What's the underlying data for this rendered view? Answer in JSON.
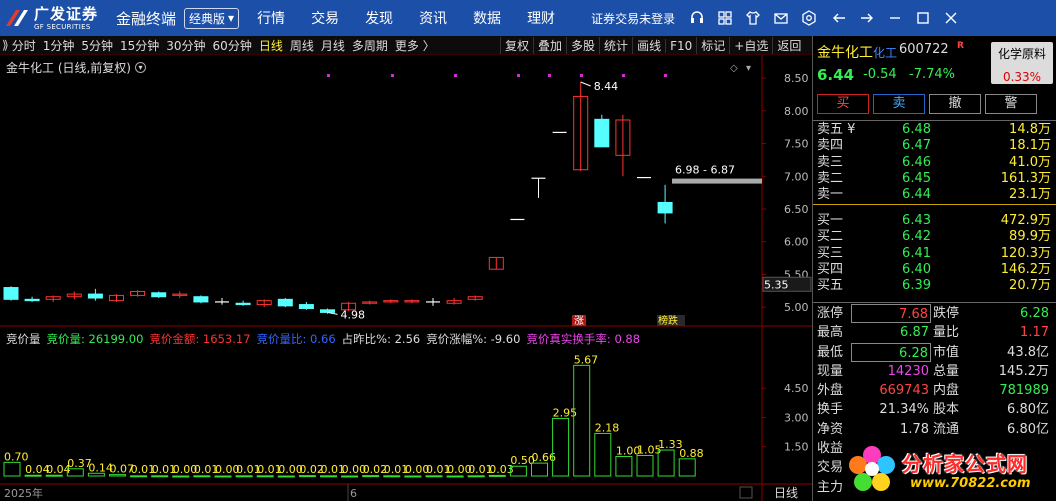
{
  "titlebar": {
    "logo_cn": "广发证券",
    "logo_en": "GF SECURITIES",
    "app_title": "金融终端",
    "edition": "经典版",
    "menu": [
      "行情",
      "交易",
      "发现",
      "资讯",
      "数据",
      "理财"
    ],
    "login": "证券交易未登录"
  },
  "toolbar": {
    "left_items": [
      "分时",
      "1分钟",
      "5分钟",
      "15分钟",
      "30分钟",
      "60分钟",
      "日线",
      "周线",
      "月线",
      "多周期",
      "更多 〉"
    ],
    "active": "日线",
    "right_items": [
      "复权",
      "叠加",
      "多股",
      "统计",
      "画线",
      "F10",
      "标记",
      "+自选",
      "返回"
    ]
  },
  "chart": {
    "stock_label": "金牛化工 (日线,前复权)",
    "high_label": "8.44",
    "low_label": "4.98",
    "range_label": "6.98 - 6.87",
    "current_price_tag": "5.35",
    "zhang_tag": "涨",
    "bang_tag": "榜跌",
    "x_label_start": "2025年",
    "x_label_6": "6",
    "period_tag": "日线"
  },
  "vol_legend": {
    "title": "竞价量",
    "items": [
      {
        "label": "竞价量: 26199.00",
        "color": "#33ee55"
      },
      {
        "label": "竞价金额: 1653.17",
        "color": "#ff3333"
      },
      {
        "label": "竞价量比: 0.66",
        "color": "#3366ff"
      },
      {
        "label": "占昨比%: 2.56",
        "color": "#dddddd"
      },
      {
        "label": "竞价涨幅%: -9.60",
        "color": "#dddddd"
      },
      {
        "label": "竞价真实换手率: 0.88",
        "color": "#ee44ee"
      }
    ]
  },
  "chart_data": [
    {
      "type": "candlestick",
      "title": "金牛化工 (日线,前复权)",
      "y_ticks": [
        8.5,
        8.0,
        7.5,
        7.0,
        6.5,
        6.0,
        5.5,
        5.0
      ],
      "ylim": [
        4.85,
        8.7
      ],
      "candles": [
        {
          "o": 5.3,
          "h": 5.32,
          "l": 5.1,
          "c": 5.12
        },
        {
          "o": 5.12,
          "h": 5.16,
          "l": 5.08,
          "c": 5.1
        },
        {
          "o": 5.12,
          "h": 5.18,
          "l": 5.08,
          "c": 5.16
        },
        {
          "o": 5.16,
          "h": 5.24,
          "l": 5.12,
          "c": 5.2
        },
        {
          "o": 5.2,
          "h": 5.28,
          "l": 5.1,
          "c": 5.14
        },
        {
          "o": 5.1,
          "h": 5.2,
          "l": 5.08,
          "c": 5.18
        },
        {
          "o": 5.18,
          "h": 5.26,
          "l": 5.16,
          "c": 5.24
        },
        {
          "o": 5.22,
          "h": 5.24,
          "l": 5.14,
          "c": 5.16
        },
        {
          "o": 5.18,
          "h": 5.24,
          "l": 5.14,
          "c": 5.2
        },
        {
          "o": 5.16,
          "h": 5.18,
          "l": 5.06,
          "c": 5.08
        },
        {
          "o": 5.08,
          "h": 5.14,
          "l": 5.04,
          "c": 5.08
        },
        {
          "o": 5.06,
          "h": 5.1,
          "l": 5.02,
          "c": 5.04
        },
        {
          "o": 5.04,
          "h": 5.12,
          "l": 5.0,
          "c": 5.1
        },
        {
          "o": 5.12,
          "h": 5.14,
          "l": 5.0,
          "c": 5.02
        },
        {
          "o": 5.04,
          "h": 5.08,
          "l": 4.96,
          "c": 4.98
        },
        {
          "o": 4.96,
          "h": 4.98,
          "l": 4.9,
          "c": 4.92
        },
        {
          "o": 4.96,
          "h": 5.08,
          "l": 4.94,
          "c": 5.06
        },
        {
          "o": 5.06,
          "h": 5.1,
          "l": 5.04,
          "c": 5.08
        },
        {
          "o": 5.08,
          "h": 5.12,
          "l": 5.06,
          "c": 5.1
        },
        {
          "o": 5.08,
          "h": 5.12,
          "l": 5.06,
          "c": 5.1
        },
        {
          "o": 5.08,
          "h": 5.14,
          "l": 5.02,
          "c": 5.08
        },
        {
          "o": 5.06,
          "h": 5.14,
          "l": 5.04,
          "c": 5.1
        },
        {
          "o": 5.12,
          "h": 5.18,
          "l": 5.1,
          "c": 5.16
        },
        {
          "o": 5.58,
          "h": 5.76,
          "l": 5.58,
          "c": 5.76
        },
        {
          "o": 6.34,
          "h": 6.34,
          "l": 6.34,
          "c": 6.34
        },
        {
          "o": 6.97,
          "h": 6.97,
          "l": 6.67,
          "c": 6.97
        },
        {
          "o": 7.67,
          "h": 7.67,
          "l": 7.67,
          "c": 7.67
        },
        {
          "o": 7.1,
          "h": 8.44,
          "l": 7.08,
          "c": 8.22
        },
        {
          "o": 7.87,
          "h": 7.94,
          "l": 7.45,
          "c": 7.45
        },
        {
          "o": 7.32,
          "h": 7.94,
          "l": 7.0,
          "c": 7.86
        },
        {
          "o": 6.98,
          "h": 6.98,
          "l": 6.98,
          "c": 6.98
        },
        {
          "o": 6.6,
          "h": 6.87,
          "l": 6.28,
          "c": 6.44
        }
      ]
    },
    {
      "type": "bar",
      "title": "竞价量",
      "y_ticks": [
        4.5,
        3.0,
        1.5
      ],
      "ylim": [
        0,
        6.2
      ],
      "values": [
        0.7,
        0.04,
        0.04,
        0.37,
        0.14,
        0.07,
        0.01,
        0.01,
        0.0,
        0.01,
        0.0,
        0.01,
        0.01,
        0.0,
        0.02,
        0.01,
        0.0,
        0.02,
        0.01,
        0.0,
        0.01,
        0.0,
        0.01,
        0.03,
        0.5,
        0.66,
        2.95,
        5.67,
        2.18,
        1.0,
        1.05,
        1.33,
        0.88
      ],
      "labels": [
        "0.70",
        "0.04",
        "0.04",
        "0.37",
        "0.14",
        "0.07",
        "0.01",
        "0.01",
        "0.00",
        "0.01",
        "0.00",
        "0.01",
        "0.01",
        "0.00",
        "0.02",
        "0.01",
        "0.00",
        "0.02",
        "0.01",
        "0.00",
        "0.01",
        "0.00",
        "0.01",
        "0.03",
        "0.50",
        "0.66",
        "2.95",
        "5.67",
        "2.18",
        "1.00",
        "1.05",
        "1.33",
        "0.88"
      ]
    }
  ],
  "quote": {
    "name": "金牛化工",
    "sector": "化工",
    "code": "600722",
    "r_mark": "R",
    "price": "6.44",
    "change": "-0.54",
    "pct": "-7.74%",
    "sector_box": {
      "name": "化学原料",
      "pct": "0.33%"
    },
    "buttons": {
      "buy": "买",
      "sell": "卖",
      "cancel": "撤",
      "warn": "警"
    },
    "asks": [
      {
        "label": "卖五",
        "mark": "¥",
        "price": "6.48",
        "vol": "14.8万"
      },
      {
        "label": "卖四",
        "mark": "",
        "price": "6.47",
        "vol": "18.1万"
      },
      {
        "label": "卖三",
        "mark": "",
        "price": "6.46",
        "vol": "41.0万"
      },
      {
        "label": "卖二",
        "mark": "",
        "price": "6.45",
        "vol": "161.3万"
      },
      {
        "label": "卖一",
        "mark": "",
        "price": "6.44",
        "vol": "23.1万"
      }
    ],
    "bids": [
      {
        "label": "买一",
        "price": "6.43",
        "vol": "472.9万"
      },
      {
        "label": "买二",
        "price": "6.42",
        "vol": "89.9万"
      },
      {
        "label": "买三",
        "price": "6.41",
        "vol": "120.3万"
      },
      {
        "label": "买四",
        "price": "6.40",
        "vol": "146.2万"
      },
      {
        "label": "买五",
        "price": "6.39",
        "vol": "20.7万"
      }
    ],
    "stats": [
      {
        "k": "涨停",
        "v": "7.68",
        "vc": "#ff4444",
        "vb": true,
        "k2": "跌停",
        "v2": "6.28",
        "v2c": "#33ee55",
        "v2b": false
      },
      {
        "k": "最高",
        "v": "6.87",
        "vc": "#33ee55",
        "vb": false,
        "k2": "量比",
        "v2": "1.17",
        "v2c": "#ff4444",
        "v2b": false
      },
      {
        "k": "最低",
        "v": "6.28",
        "vc": "#33ee55",
        "vb": true,
        "k2": "市值",
        "v2": "43.8亿",
        "v2c": "#dddddd",
        "v2b": false
      },
      {
        "k": "现量",
        "v": "14230",
        "vc": "#ee44ee",
        "vb": false,
        "k2": "总量",
        "v2": "145.2万",
        "v2c": "#dddddd",
        "v2b": false
      },
      {
        "k": "外盘",
        "v": "669743",
        "vc": "#ff4444",
        "vb": false,
        "k2": "内盘",
        "v2": "781989",
        "v2c": "#33ee55",
        "v2b": false
      },
      {
        "k": "换手",
        "v": "21.34%",
        "vc": "#dddddd",
        "vb": false,
        "k2": "股本",
        "v2": "6.80亿",
        "v2c": "#dddddd",
        "v2b": false
      },
      {
        "k": "净资",
        "v": "1.78",
        "vc": "#dddddd",
        "vb": false,
        "k2": "流通",
        "v2": "6.80亿",
        "v2c": "#dddddd",
        "v2b": false
      },
      {
        "k": "收益",
        "v": "",
        "vc": "#dddddd",
        "vb": false,
        "k2": "",
        "v2": "",
        "v2c": "#dddddd",
        "v2b": false
      },
      {
        "k": "交易",
        "v": "",
        "vc": "#dddddd",
        "vb": false,
        "k2": "",
        "v2": "",
        "v2c": "#dddddd",
        "v2b": false
      },
      {
        "k": "主力",
        "v": "",
        "vc": "#dddddd",
        "vb": false,
        "k2": "",
        "v2": "",
        "v2c": "#dddddd",
        "v2b": false
      }
    ]
  },
  "watermark": {
    "text": "分析家公式网",
    "url": "www.70822.com"
  }
}
